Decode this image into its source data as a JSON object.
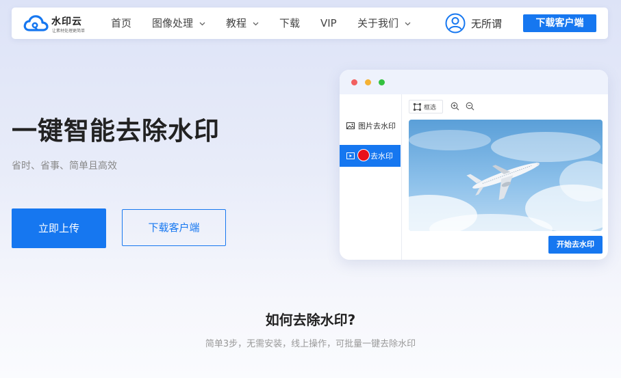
{
  "brand": {
    "name": "水印云",
    "slogan": "让素材处理更简单",
    "color": "#1677f0"
  },
  "nav": {
    "items": [
      {
        "label": "首页",
        "dropdown": false
      },
      {
        "label": "图像处理",
        "dropdown": true
      },
      {
        "label": "教程",
        "dropdown": true
      },
      {
        "label": "下载",
        "dropdown": false
      },
      {
        "label": "VIP",
        "dropdown": false
      },
      {
        "label": "关于我们",
        "dropdown": true
      }
    ],
    "user_name": "无所谓",
    "download_label": "下载客户端"
  },
  "hero": {
    "title": "一键智能去除水印",
    "subtitle": "省时、省事、简单且高效",
    "upload_label": "立即上传",
    "client_label": "下载客户端"
  },
  "app": {
    "sidebar": [
      {
        "label": "图片去水印",
        "active": false
      },
      {
        "label": "视频去水印",
        "visible_label": "去水印",
        "active": true
      }
    ],
    "toolbar": {
      "select_label": "框选",
      "zoom_in_icon": "zoom-in-icon",
      "zoom_out_icon": "zoom-out-icon"
    },
    "preview_image": "airplane-in-sky",
    "start_label": "开始去水印"
  },
  "section": {
    "title": "如何去除水印?",
    "subtitle": "简单3步，无需安装，线上操作，可批量一键去除水印"
  }
}
